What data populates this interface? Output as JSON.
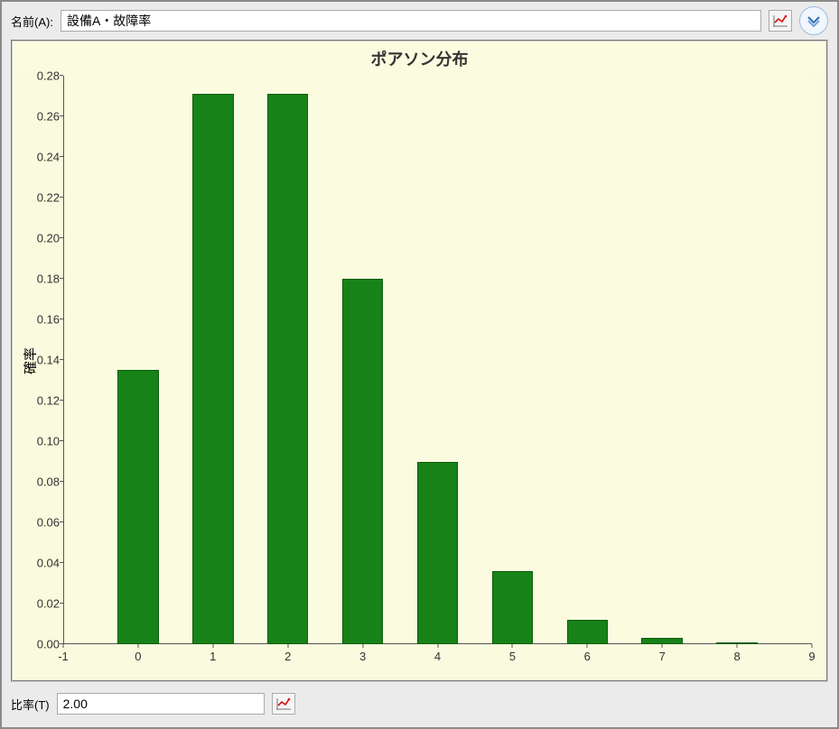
{
  "header": {
    "name_label": "名前(A):",
    "name_value": "設備A・故障率"
  },
  "footer": {
    "ratio_label": "比率(T)",
    "ratio_value": "2.00"
  },
  "chart_data": {
    "type": "bar",
    "title": "ポアソン分布",
    "ylabel": "確率",
    "xlabel": "",
    "categories": [
      0,
      1,
      2,
      3,
      4,
      5,
      6,
      7,
      8
    ],
    "values": [
      0.135,
      0.271,
      0.271,
      0.18,
      0.09,
      0.036,
      0.012,
      0.003,
      0.001
    ],
    "xlim": [
      -1,
      9
    ],
    "ylim": [
      0.0,
      0.28
    ],
    "x_ticks": [
      -1,
      0,
      1,
      2,
      3,
      4,
      5,
      6,
      7,
      8,
      9
    ],
    "y_ticks": [
      0.0,
      0.02,
      0.04,
      0.06,
      0.08,
      0.1,
      0.12,
      0.14,
      0.16,
      0.18,
      0.2,
      0.22,
      0.24,
      0.26,
      0.28
    ],
    "bar_color": "#178217"
  }
}
